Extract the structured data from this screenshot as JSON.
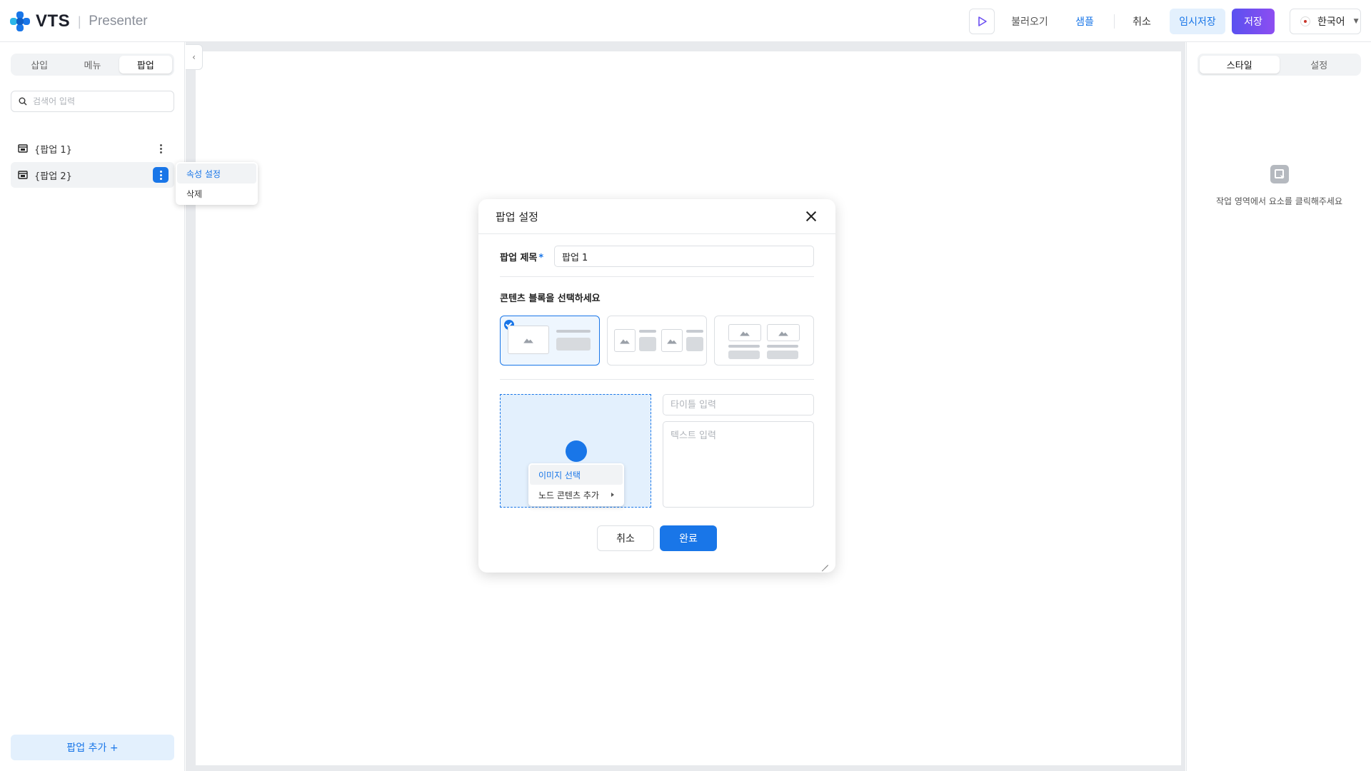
{
  "app": {
    "brand": "VTS",
    "product": "Presenter",
    "brand_colors": [
      "#1976e8",
      "#2bb5e8"
    ]
  },
  "header": {
    "load_label": "불러오기",
    "sample_label": "샘플",
    "cancel_label": "취소",
    "draft_label": "임시저장",
    "save_label": "저장",
    "language": "한국어"
  },
  "sidebar": {
    "tabs": [
      "삽입",
      "메뉴",
      "팝업"
    ],
    "active_tab": "팝업",
    "search_placeholder": "검색어 입력",
    "items": [
      {
        "label": "{팝업 1}"
      },
      {
        "label": "{팝업 2}",
        "selected": true
      }
    ],
    "context_menu": [
      "속성 설정",
      "삭제"
    ],
    "add_label": "팝업 추가 +"
  },
  "right_panel": {
    "tabs": [
      "스타일",
      "설정"
    ],
    "active_tab": "스타일",
    "empty_message": "작업 영역에서 요소를 클릭해주세요"
  },
  "modal": {
    "title": "팝업 설정",
    "title_field_label": "팝업 제목",
    "required_mark": "*",
    "title_value": "팝업 1",
    "section_label": "콘텐츠 블록을 선택하세요",
    "selected_block": 1,
    "image_menu": [
      "이미지 선택",
      "노드 콘텐츠 추가"
    ],
    "title_placeholder": "타이틀 입력",
    "text_placeholder": "텍스트 입력",
    "cancel_label": "취소",
    "done_label": "완료"
  },
  "colors": {
    "accent": "#1976e8",
    "save_gradient": [
      "#5a50f0",
      "#8d4ef1"
    ]
  }
}
